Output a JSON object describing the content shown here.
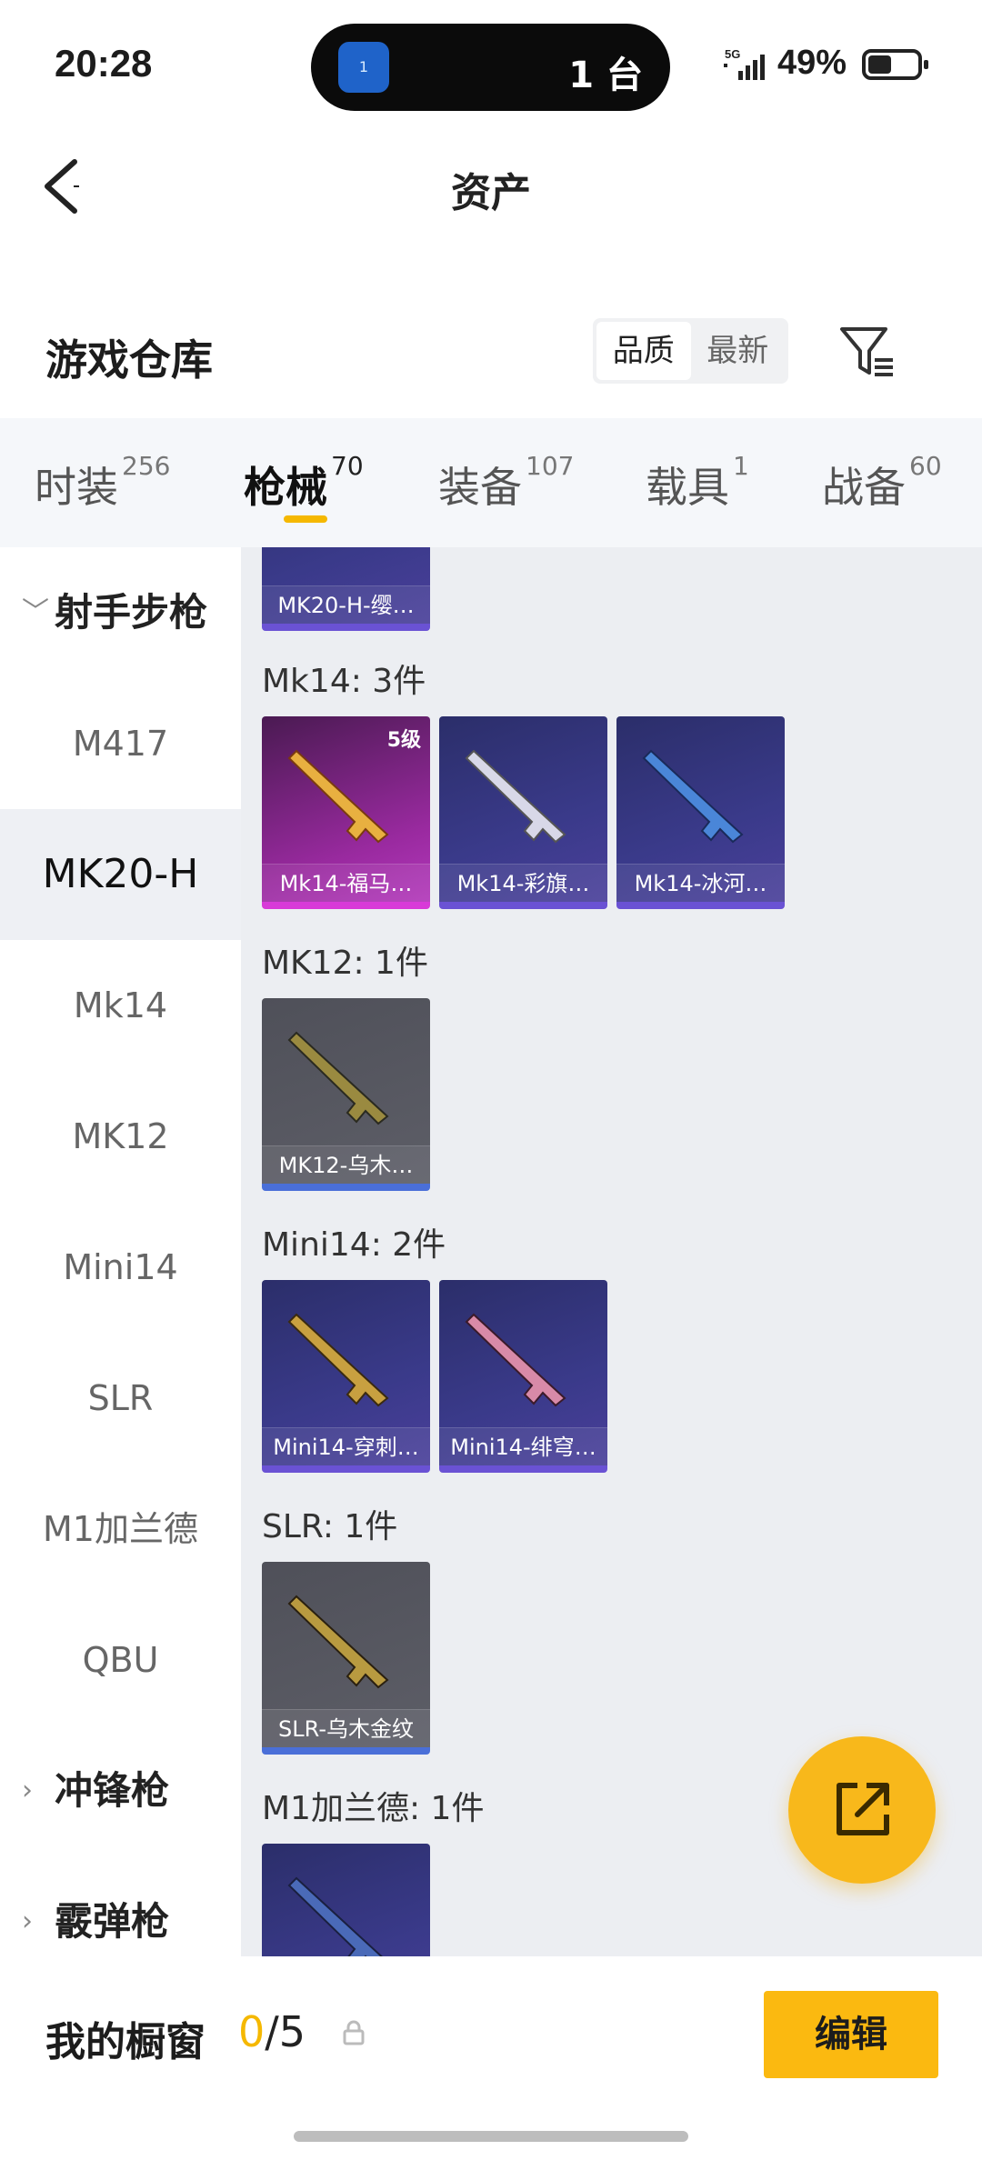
{
  "status": {
    "time": "20:28",
    "island_badge": "1",
    "island_text": "1 台",
    "network": "5G",
    "battery_pct": "49%",
    "battery_level": 0.49
  },
  "nav": {
    "title": "资产",
    "back_icon": "chevron-left-icon"
  },
  "header": {
    "title": "游戏仓库",
    "sort_options": [
      "品质",
      "最新"
    ],
    "sort_selected": "品质",
    "filter_icon": "filter-icon"
  },
  "tabs": [
    {
      "label": "时装",
      "count": "256"
    },
    {
      "label": "枪械",
      "count": "70"
    },
    {
      "label": "装备",
      "count": "107"
    },
    {
      "label": "载具",
      "count": "1"
    },
    {
      "label": "战备",
      "count": "60"
    }
  ],
  "tab_selected": "枪械",
  "sidebar": {
    "group1": "射手步枪",
    "items": [
      "M417",
      "MK20-H",
      "Mk14",
      "MK12",
      "Mini14",
      "SLR",
      "M1加兰德",
      "QBU"
    ],
    "selected": "MK20-H",
    "group2": "冲锋枪",
    "group3": "霰弹枪"
  },
  "content": {
    "top_card_name": "MK20-H-缨…",
    "groups": [
      {
        "label": "Mk14: 3件",
        "items": [
          {
            "name": "Mk14-福马…",
            "level": "5级",
            "rarity": "pink"
          },
          {
            "name": "Mk14-彩旗…",
            "rarity": "purple"
          },
          {
            "name": "Mk14-冰河…",
            "rarity": "purple"
          }
        ]
      },
      {
        "label": "MK12: 1件",
        "items": [
          {
            "name": "MK12-乌木…",
            "rarity": "gray"
          }
        ]
      },
      {
        "label": "Mini14: 2件",
        "items": [
          {
            "name": "Mini14-穿刺…",
            "rarity": "purple"
          },
          {
            "name": "Mini14-绯穹…",
            "rarity": "purple"
          }
        ]
      },
      {
        "label": "SLR: 1件",
        "items": [
          {
            "name": "SLR-乌木金纹",
            "rarity": "gray"
          }
        ]
      },
      {
        "label": "M1加兰德: 1件",
        "items": []
      }
    ]
  },
  "fab_icon": "share-icon",
  "bottom": {
    "label": "我的橱窗",
    "current": "0",
    "total": "/5",
    "lock_icon": "lock-icon",
    "edit_label": "编辑"
  }
}
